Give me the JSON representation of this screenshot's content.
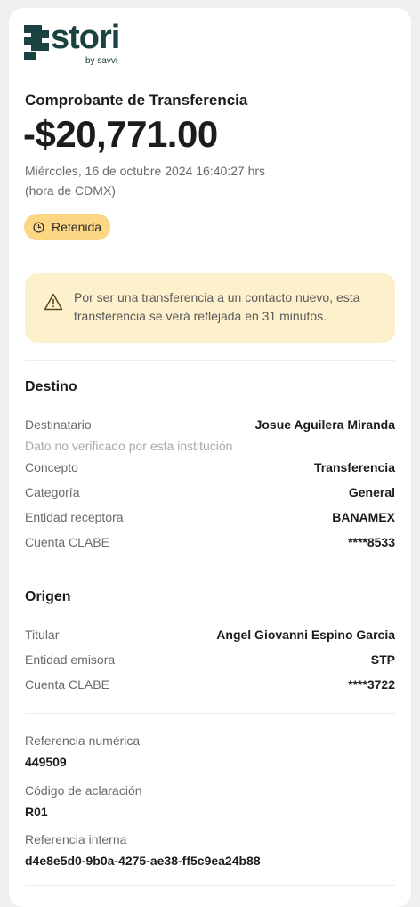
{
  "brand": {
    "name": "stori",
    "sub": "by savvi",
    "color": "#1b4140"
  },
  "header": {
    "title": "Comprobante de Transferencia",
    "amount": "-$20,771.00",
    "date": "Miércoles, 16 de octubre 2024 16:40:27 hrs",
    "timezone": "(hora de CDMX)",
    "status": "Retenida"
  },
  "alert": {
    "text": "Por ser una transferencia a un contacto nuevo, esta transferencia se verá reflejada en 31 minutos."
  },
  "destino": {
    "title": "Destino",
    "rows": [
      {
        "label": "Destinatario",
        "value": "Josue Aguilera Miranda"
      },
      {
        "label": "Concepto",
        "value": "Transferencia"
      },
      {
        "label": "Categoría",
        "value": "General"
      },
      {
        "label": "Entidad receptora",
        "value": "BANAMEX"
      },
      {
        "label": "Cuenta CLABE",
        "value": "****8533"
      }
    ],
    "note": "Dato no verificado por esta institución"
  },
  "origen": {
    "title": "Origen",
    "rows": [
      {
        "label": "Titular",
        "value": "Angel Giovanni Espino Garcia"
      },
      {
        "label": "Entidad emisora",
        "value": "STP"
      },
      {
        "label": "Cuenta CLABE",
        "value": "****3722"
      }
    ]
  },
  "references": [
    {
      "label": "Referencia numérica",
      "value": "449509"
    },
    {
      "label": "Código de aclaración",
      "value": "R01"
    },
    {
      "label": "Referencia interna",
      "value": "d4e8e5d0-9b0a-4275-ae38-ff5c9ea24b88"
    }
  ],
  "colors": {
    "badge": "#fcd682",
    "alert_bg": "#fdf0cc",
    "muted": "#6a6a6a"
  },
  "icons": {
    "status": "clock-icon",
    "alert": "warning-triangle-icon"
  }
}
